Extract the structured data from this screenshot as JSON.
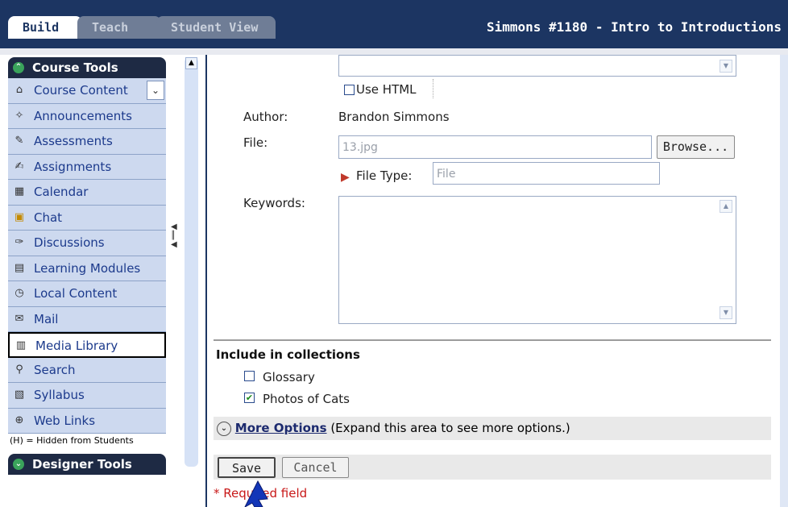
{
  "tabs": {
    "build": "Build",
    "teach": "Teach",
    "student_view": "Student View"
  },
  "course_title": "Simmons #1180 - Intro to Introductions",
  "sidebar": {
    "header": "Course Tools",
    "items": [
      {
        "label": "Course Content",
        "icon": "house-icon"
      },
      {
        "label": "Announcements",
        "icon": "megaphone-icon"
      },
      {
        "label": "Assessments",
        "icon": "assessment-icon"
      },
      {
        "label": "Assignments",
        "icon": "assignment-icon"
      },
      {
        "label": "Calendar",
        "icon": "calendar-icon"
      },
      {
        "label": "Chat",
        "icon": "chat-icon"
      },
      {
        "label": "Discussions",
        "icon": "pin-icon"
      },
      {
        "label": "Learning Modules",
        "icon": "module-icon"
      },
      {
        "label": "Local Content",
        "icon": "clock-icon"
      },
      {
        "label": "Mail",
        "icon": "mail-icon"
      },
      {
        "label": "Media Library",
        "icon": "media-icon"
      },
      {
        "label": "Search",
        "icon": "search-icon"
      },
      {
        "label": "Syllabus",
        "icon": "syllabus-icon"
      },
      {
        "label": "Web Links",
        "icon": "globe-icon"
      }
    ],
    "note": "(H) = Hidden from Students",
    "designer_header": "Designer Tools"
  },
  "form": {
    "use_html": "Use HTML",
    "author_label": "Author:",
    "author_value": "Brandon Simmons",
    "file_label": "File:",
    "file_value": "13.jpg",
    "browse": "Browse...",
    "file_type_label": "File Type:",
    "file_type_value": "File",
    "keywords_label": "Keywords:"
  },
  "collections": {
    "heading": "Include in collections",
    "items": [
      {
        "label": "Glossary",
        "checked": false
      },
      {
        "label": "Photos of Cats",
        "checked": true
      }
    ]
  },
  "more_options": {
    "link": "More Options",
    "hint": "(Expand this area to see more options.)"
  },
  "buttons": {
    "save": "Save",
    "cancel": "Cancel"
  },
  "required": "* Required field"
}
